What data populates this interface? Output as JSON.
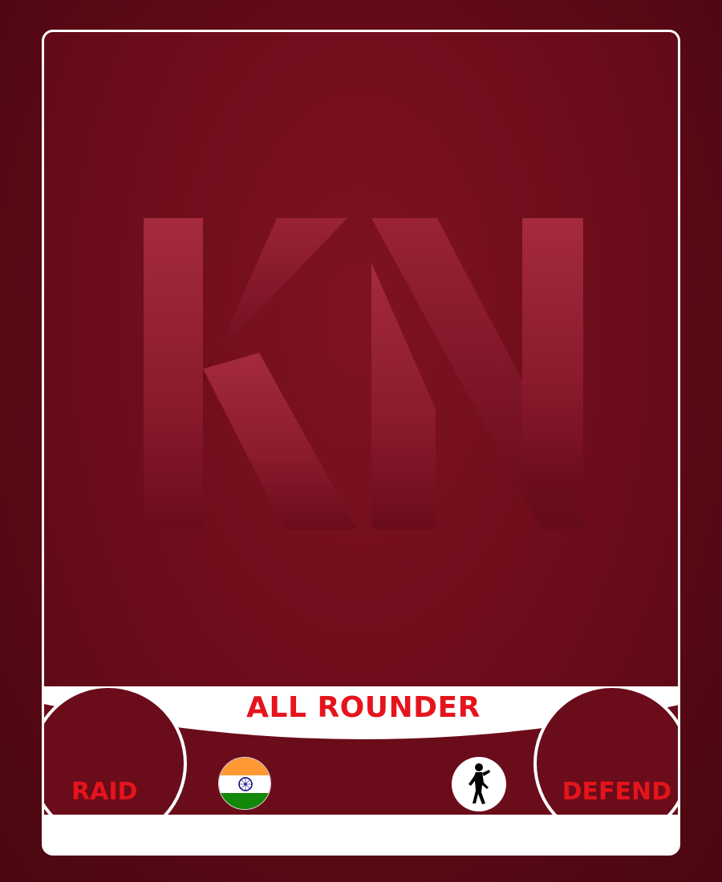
{
  "card": {
    "logo_text": "KN",
    "role": "ALL ROUNDER",
    "raid_label": "RAID",
    "defend_label": "DEFEND",
    "country_icon": "india-flag-icon",
    "player_icon": "runner-silhouette-icon"
  },
  "colors": {
    "background": "#5e0a16",
    "accent": "#e5141c",
    "panel": "#ffffff"
  }
}
